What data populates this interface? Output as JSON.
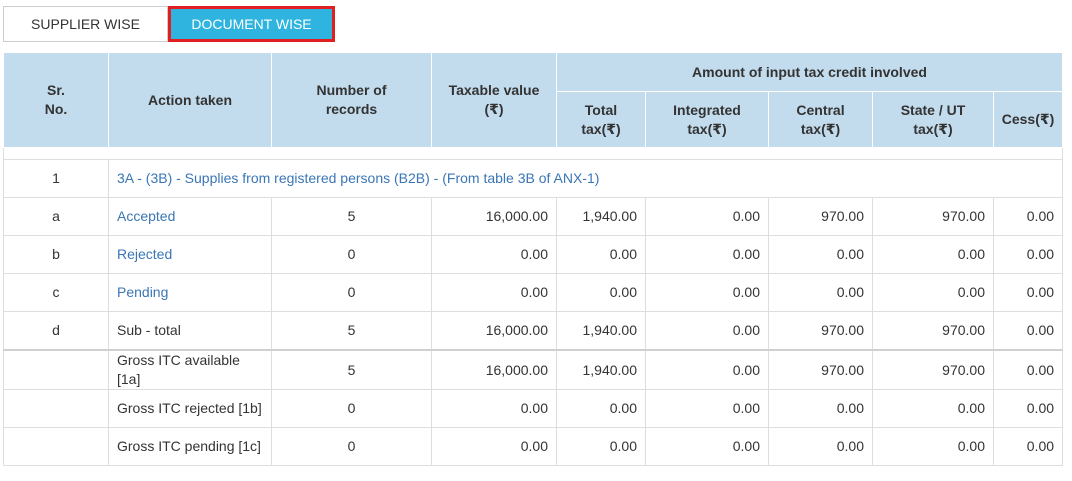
{
  "tabs": {
    "supplier_wise": "SUPPLIER WISE",
    "document_wise": "DOCUMENT WISE"
  },
  "header": {
    "sr_no": "Sr.\nNo.",
    "action_taken": "Action taken",
    "number_of_records": "Number of\nrecords",
    "taxable_value": "Taxable value\n(₹)",
    "itc_group": "Amount of input tax credit involved",
    "total_tax": "Total\ntax(₹)",
    "integrated_tax": "Integrated\ntax(₹)",
    "central_tax": "Central\ntax(₹)",
    "state_ut_tax": "State / UT\ntax(₹)",
    "cess": "Cess(₹)"
  },
  "section": {
    "sr": "1",
    "title": "3A - (3B) - Supplies from registered persons (B2B) - (From table 3B of ANX-1)"
  },
  "rows": [
    {
      "sr": "a",
      "action": "Accepted",
      "records": "5",
      "taxable": "16,000.00",
      "total": "1,940.00",
      "integrated": "0.00",
      "central": "970.00",
      "state": "970.00",
      "cess": "0.00"
    },
    {
      "sr": "b",
      "action": "Rejected",
      "records": "0",
      "taxable": "0.00",
      "total": "0.00",
      "integrated": "0.00",
      "central": "0.00",
      "state": "0.00",
      "cess": "0.00"
    },
    {
      "sr": "c",
      "action": "Pending",
      "records": "0",
      "taxable": "0.00",
      "total": "0.00",
      "integrated": "0.00",
      "central": "0.00",
      "state": "0.00",
      "cess": "0.00"
    },
    {
      "sr": "d",
      "action": "Sub - total",
      "records": "5",
      "taxable": "16,000.00",
      "total": "1,940.00",
      "integrated": "0.00",
      "central": "970.00",
      "state": "970.00",
      "cess": "0.00"
    }
  ],
  "summary": [
    {
      "sr": "",
      "action": "Gross ITC available\n[1a]",
      "records": "5",
      "taxable": "16,000.00",
      "total": "1,940.00",
      "integrated": "0.00",
      "central": "970.00",
      "state": "970.00",
      "cess": "0.00"
    },
    {
      "sr": "",
      "action": "Gross ITC rejected [1b]",
      "records": "0",
      "taxable": "0.00",
      "total": "0.00",
      "integrated": "0.00",
      "central": "0.00",
      "state": "0.00",
      "cess": "0.00"
    },
    {
      "sr": "",
      "action": "Gross ITC pending [1c]",
      "records": "0",
      "taxable": "0.00",
      "total": "0.00",
      "integrated": "0.00",
      "central": "0.00",
      "state": "0.00",
      "cess": "0.00"
    }
  ],
  "colors": {
    "header_bg": "#c2dbed",
    "active_tab": "#2fb4e0",
    "highlight_border": "#e02020",
    "link": "#3a76b5"
  }
}
